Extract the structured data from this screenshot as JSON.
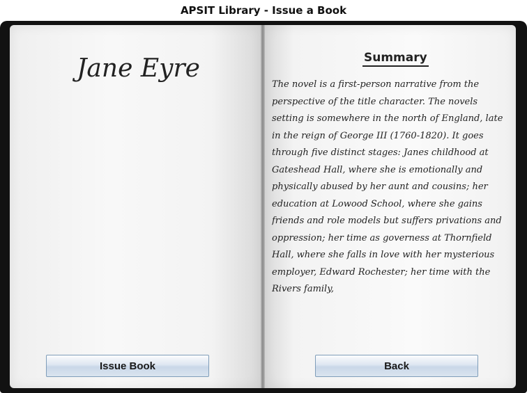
{
  "window": {
    "title": "APSIT Library - Issue a Book"
  },
  "book": {
    "title": "Jane Eyre"
  },
  "summary": {
    "heading": "Summary",
    "text": "The novel is a first-person narrative from the perspective of the title character. The novels setting is somewhere in the north of England, late in the reign of George III (1760-1820). It goes through five distinct stages: Janes childhood at Gateshead Hall, where she is emotionally and physically abused by her aunt and cousins; her education at Lowood School, where she gains friends and role models but suffers privations and oppression; her time as governess at Thornfield Hall, where she falls in love with her mysterious employer, Edward Rochester; her time with the Rivers family,"
  },
  "buttons": {
    "issue": "Issue Book",
    "back": "Back"
  }
}
